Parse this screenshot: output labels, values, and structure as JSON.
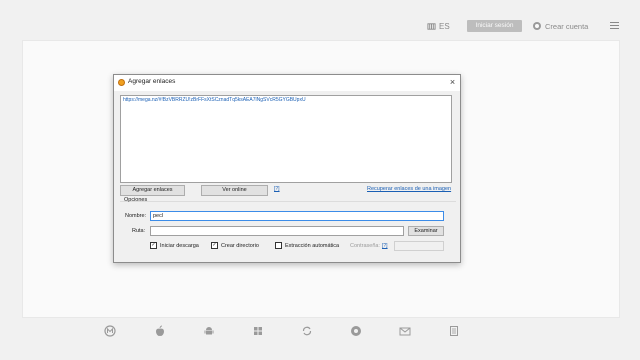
{
  "header": {
    "language": "ES",
    "login_label": "Iniciar sesión",
    "create_label": "Crear cuenta"
  },
  "dialog": {
    "title": "Agregar enlaces",
    "close_glyph": "×",
    "links_text": "https://mega.nz/#!BzVBRRZU!zBrFFsXtSCznadTq5ksAEA7lNgSVcR5GYGBUpxU",
    "add_links_label": "Agregar enlaces",
    "view_online_label": "Ver online",
    "help1": "[?]",
    "recover_label": "Recuperar enlaces de una imagen",
    "options_label": "Opciones",
    "name_label": "Nombre:",
    "name_value": "pecl",
    "path_label": "Ruta:",
    "path_value": "",
    "browse_label": "Examinar",
    "start_download_label": "Iniciar descarga",
    "create_dir_label": "Crear directorio",
    "auto_extract_label": "Extracción automática",
    "password_label": "Contraseña:",
    "help2": "[?]"
  },
  "bottom_icons": [
    "megasync-icon",
    "apple-icon",
    "android-icon",
    "windows-icon",
    "sync-icon",
    "browser-icon",
    "mail-icon",
    "document-icon"
  ]
}
